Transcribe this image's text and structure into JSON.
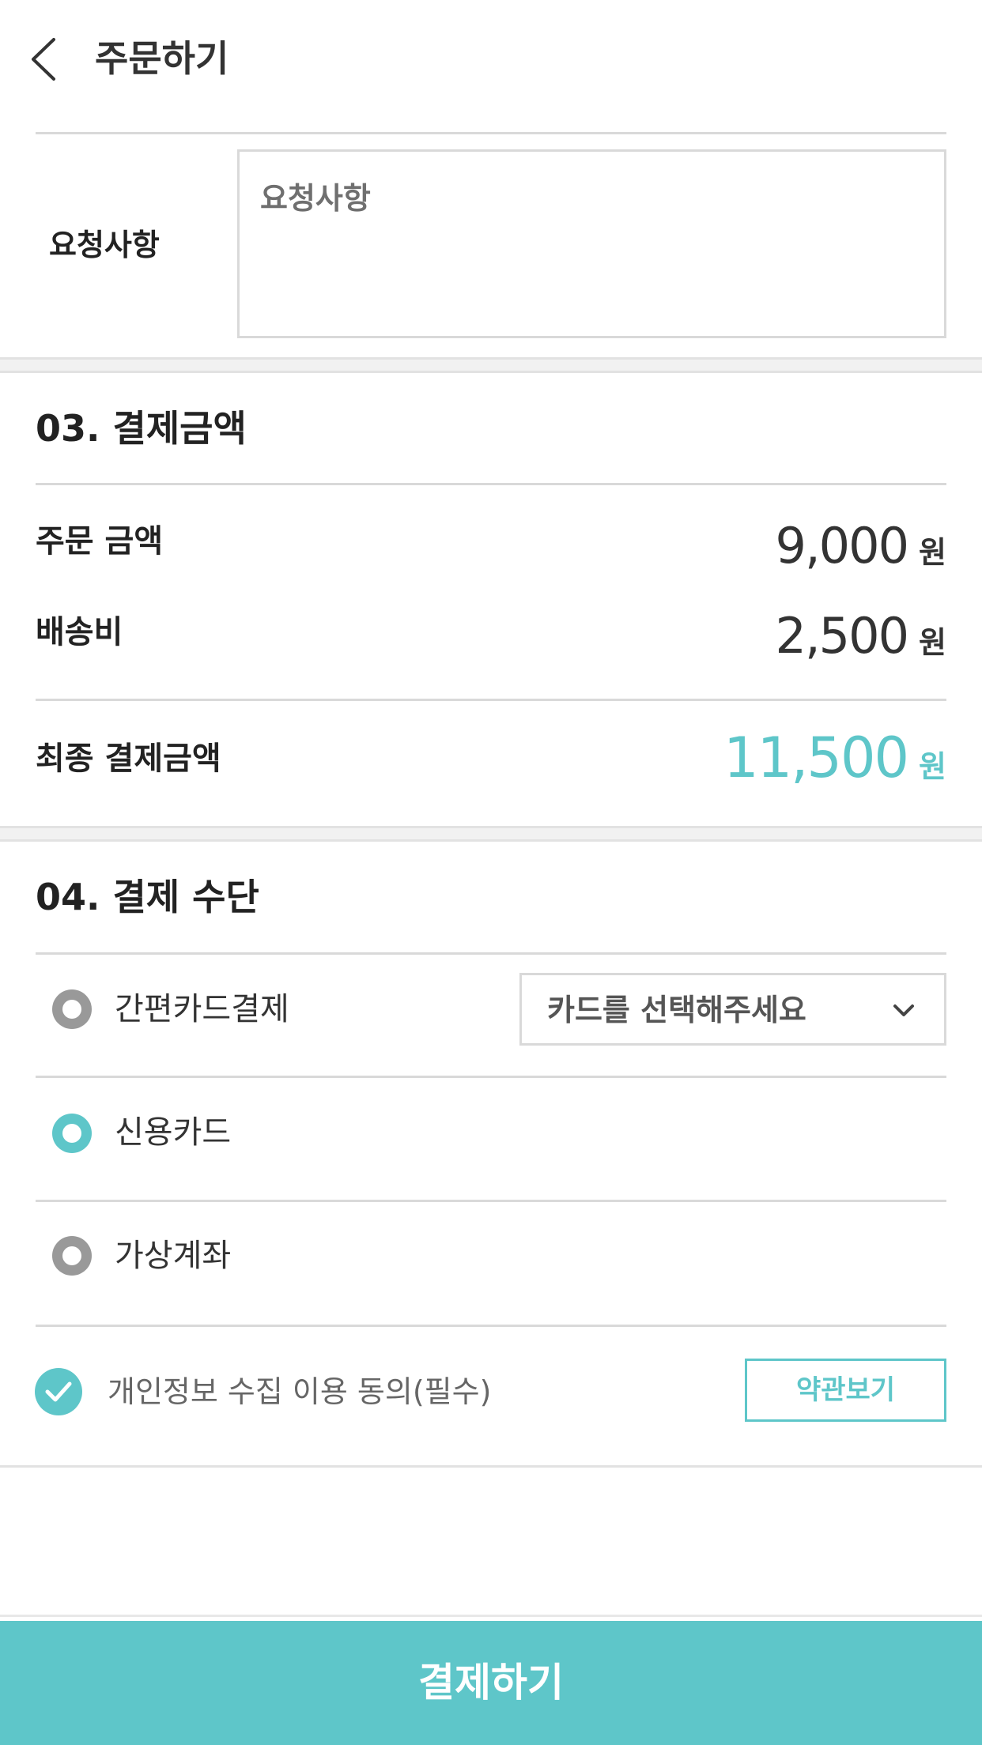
{
  "header": {
    "title": "주문하기",
    "back_icon": "chevron-left-icon"
  },
  "request": {
    "label": "요청사항",
    "placeholder": "요청사항",
    "value": ""
  },
  "payment_amount": {
    "section_title": "03. 결제금액",
    "order_label": "주문 금액",
    "order_amount": "9,000",
    "shipping_label": "배송비",
    "shipping_amount": "2,500",
    "total_label": "최종 결제금액",
    "total_amount": "11,500",
    "unit": "원"
  },
  "payment_method": {
    "section_title": "04. 결제 수단",
    "options": [
      {
        "label": "간편카드결제",
        "selected": false
      },
      {
        "label": "신용카드",
        "selected": true
      },
      {
        "label": "가상계좌",
        "selected": false
      }
    ],
    "card_select": {
      "value": "카드를 선택해주세요"
    }
  },
  "agreement": {
    "label": "개인정보 수집 이용 동의(필수)",
    "checked": true,
    "terms_button": "약관보기"
  },
  "pay_button": "결제하기",
  "colors": {
    "accent": "#5ec6c9",
    "radio_off": "#999999",
    "divider": "#d9d9d9"
  }
}
